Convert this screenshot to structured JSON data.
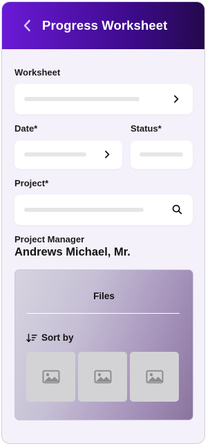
{
  "header": {
    "title": "Progress Worksheet",
    "back_icon": "chevron-left-icon"
  },
  "form": {
    "worksheet": {
      "label": "Worksheet",
      "value": ""
    },
    "date": {
      "label": "Date*",
      "value": ""
    },
    "status": {
      "label": "Status*",
      "value": ""
    },
    "project": {
      "label": "Project*",
      "value": ""
    }
  },
  "project_manager": {
    "label": "Project Manager",
    "value": "Andrews Michael, Mr."
  },
  "files": {
    "title": "Files",
    "sort_label": "Sort by",
    "sort_icon": "sort-descending-icon",
    "thumbnails": [
      "image-icon",
      "image-icon",
      "image-icon"
    ]
  },
  "colors": {
    "header_gradient_start": "#6a1ad6",
    "header_gradient_end": "#24094c",
    "background": "#f4f1fb",
    "thumbnail": "#d3d3d5",
    "placeholder_bar": "#e6e6e8"
  }
}
